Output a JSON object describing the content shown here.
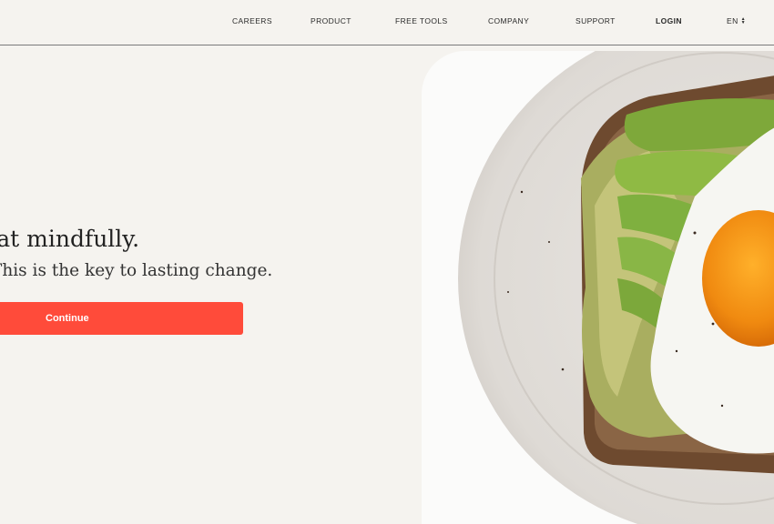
{
  "nav": {
    "items": [
      {
        "label": "CAREERS"
      },
      {
        "label": "PRODUCT"
      },
      {
        "label": "FREE TOOLS"
      },
      {
        "label": "COMPANY"
      },
      {
        "label": "SUPPORT"
      },
      {
        "label": "LOGIN"
      }
    ],
    "language": "EN",
    "language_icon": "sort-arrows-icon"
  },
  "hero": {
    "headline": "Eat mindfully.",
    "subhead": "This is the key to lasting change.",
    "cta_label": "Continue",
    "image_subject": "avocado toast with fried egg on a plate"
  },
  "colors": {
    "background": "#f5f3ef",
    "accent": "#ff4b3a"
  }
}
